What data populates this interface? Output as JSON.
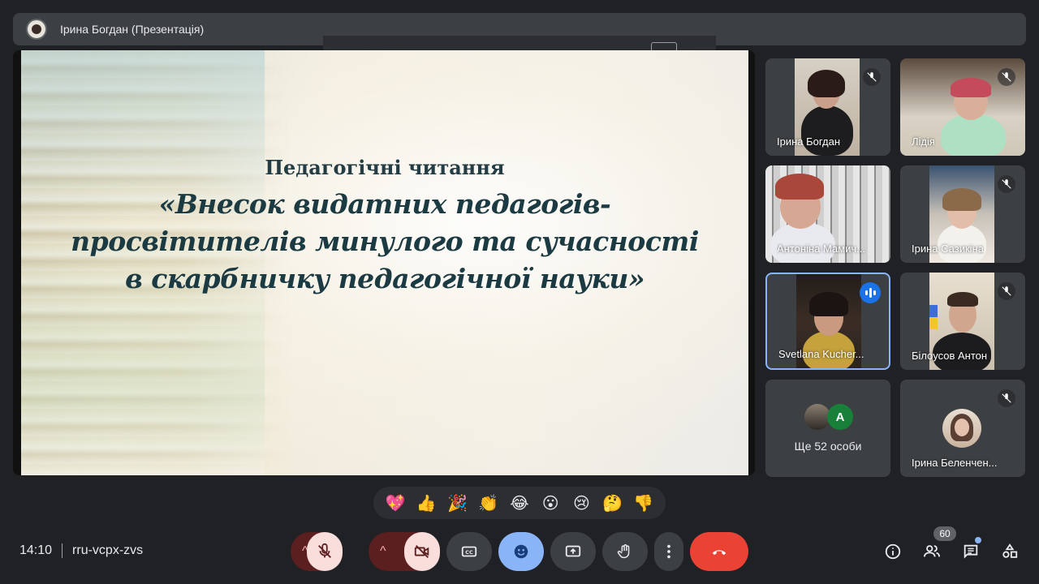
{
  "presenter": {
    "name": "Ірина Богдан (Презентація)"
  },
  "slide": {
    "heading": "Педагогічні читання",
    "title_lines": [
      "«Внесок видатних педагогів-",
      "просвітителів минулого та сучасності",
      "в скарбничку педагогічної науки»"
    ]
  },
  "participants": [
    {
      "name": "Ірина Богдан",
      "muted": true
    },
    {
      "name": "Лідія",
      "muted": true
    },
    {
      "name": "Антоніна Мамич...",
      "muted": false
    },
    {
      "name": "Ірина Сазикіна",
      "muted": true
    },
    {
      "name": "Svetlana Kucher...",
      "speaking": true
    },
    {
      "name": "Білоусов Антон",
      "muted": true
    },
    {
      "name": "Ірина Беленчен...",
      "muted": true
    }
  ],
  "others": {
    "label": "Ще 52 особи",
    "avatar_letter": "A"
  },
  "reactions": [
    "💖",
    "👍",
    "🎉",
    "👏",
    "😂",
    "😮",
    "😢",
    "🤔",
    "👎"
  ],
  "meeting": {
    "time": "14:10",
    "code": "rru-vcpx-zvs"
  },
  "controls": {
    "participant_count": "60"
  },
  "colors": {
    "background": "#202124",
    "tile": "#3c4043",
    "accent_blue": "#8ab4f8",
    "end_call": "#ea4335",
    "muted_control": "#f9dedc"
  }
}
